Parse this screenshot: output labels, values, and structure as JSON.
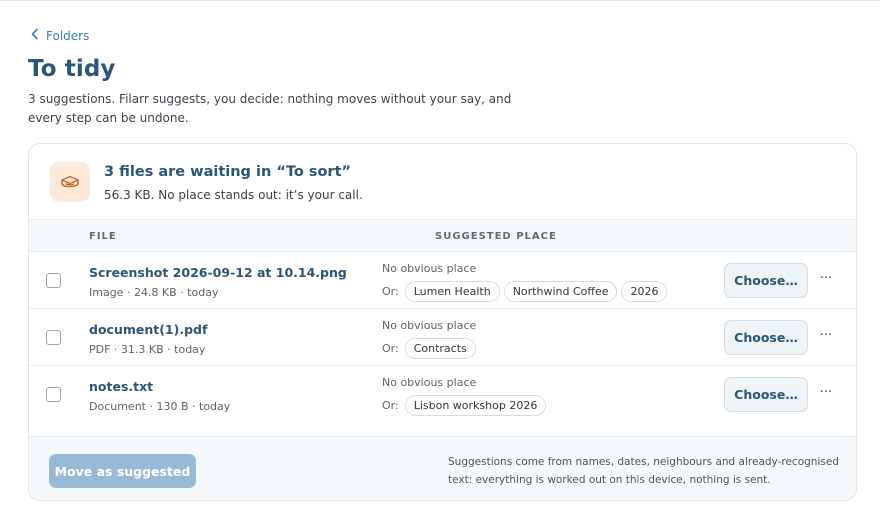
{
  "nav": {
    "back_label": "Folders",
    "back_icon": "chevron-left-icon"
  },
  "page": {
    "title": "To tidy",
    "intro": "3 suggestions. Filarr suggests, you decide: nothing moves without your say, and every step can be undone."
  },
  "summary": {
    "icon": "box-icon",
    "title": "3 files are waiting in “To sort”",
    "subtitle": "56.3 KB. No place stands out: it’s your call."
  },
  "table": {
    "columns": [
      "FILE",
      "SUGGESTED PLACE"
    ],
    "rows": [
      {
        "name": "Screenshot 2026-09-12 at 10.14.png",
        "meta": "Image · 24.8 KB · today",
        "place": "No obvious place",
        "or_label": "Or:",
        "options": [
          "Lumen Health",
          "Northwind Coffee",
          "2026"
        ],
        "action": "Choose…",
        "more": "···"
      },
      {
        "name": "document(1).pdf",
        "meta": "PDF · 31.3 KB · today",
        "place": "No obvious place",
        "or_label": "Or:",
        "options": [
          "Contracts"
        ],
        "action": "Choose…",
        "more": "···"
      },
      {
        "name": "notes.txt",
        "meta": "Document · 130 B · today",
        "place": "No obvious place",
        "or_label": "Or:",
        "options": [
          "Lisbon workshop 2026"
        ],
        "action": "Choose…",
        "more": "···"
      }
    ]
  },
  "footer": {
    "move_label": "Move as suggested",
    "note": "Suggestions come from names, dates, neighbours and already-recognised text: everything is worked out on this device, nothing is sent."
  },
  "colors": {
    "accent": "#2c5577",
    "link": "#3d7cae",
    "disabled_button": "#98b9d6",
    "icon_bg": "#fbeadb",
    "icon_stroke": "#c56a2a"
  }
}
